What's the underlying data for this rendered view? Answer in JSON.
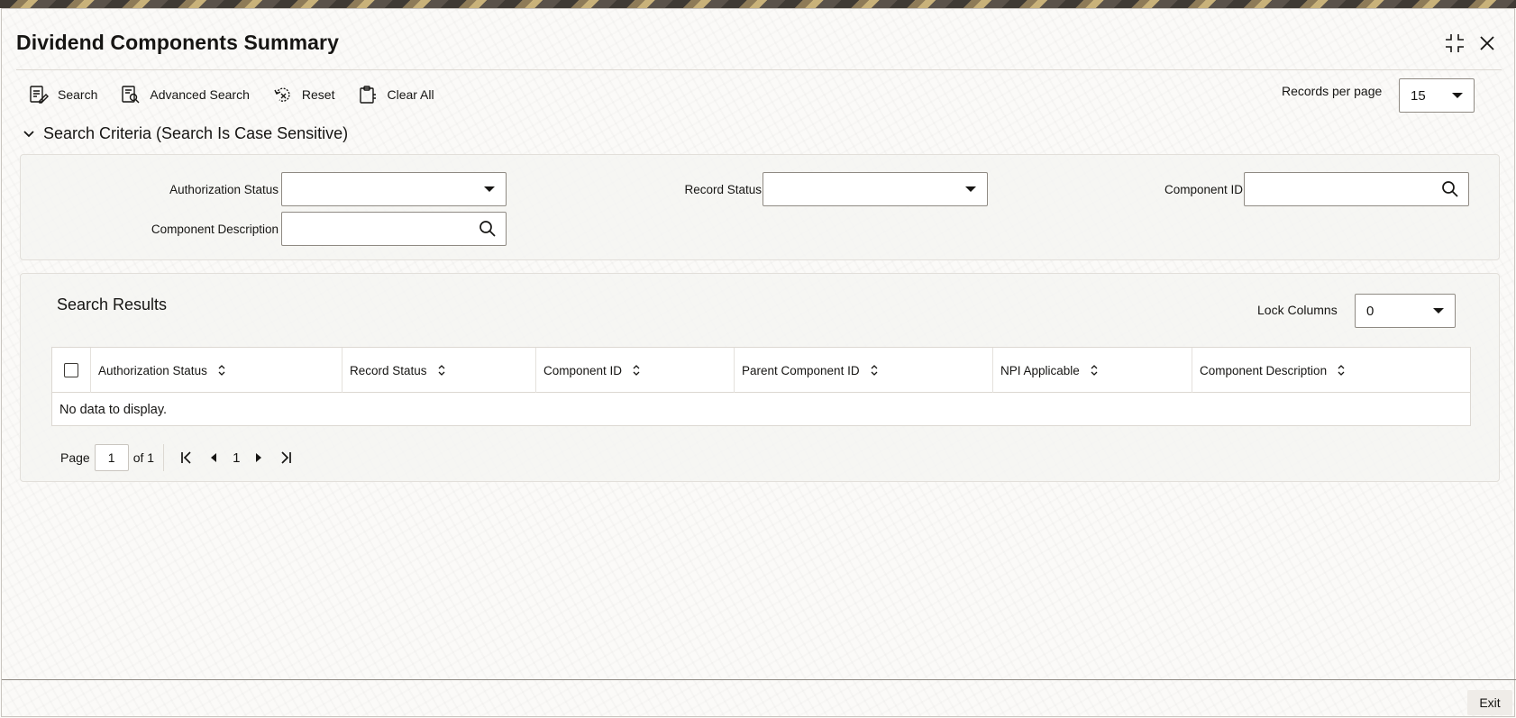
{
  "window": {
    "title": "Dividend Components Summary",
    "controls": {
      "expand_icon": "expand-icon",
      "close_icon": "close-icon"
    }
  },
  "toolbar": {
    "search": "Search",
    "advanced_search": "Advanced Search",
    "reset": "Reset",
    "clear_all": "Clear All",
    "records_per_page_label": "Records per page",
    "records_per_page_value": "15"
  },
  "criteria": {
    "title": "Search Criteria (Search Is Case Sensitive)",
    "fields": {
      "authorization_status": {
        "label": "Authorization Status",
        "value": ""
      },
      "record_status": {
        "label": "Record Status",
        "value": ""
      },
      "component_id": {
        "label": "Component ID",
        "value": ""
      },
      "component_description": {
        "label": "Component Description",
        "value": ""
      }
    }
  },
  "results": {
    "title": "Search Results",
    "lock_columns_label": "Lock Columns",
    "lock_columns_value": "0",
    "columns": [
      "Authorization Status",
      "Record Status",
      "Component ID",
      "Parent Component ID",
      "NPI Applicable",
      "Component Description"
    ],
    "rows": [],
    "empty_message": "No data to display."
  },
  "pagination": {
    "page_label": "Page",
    "current_page": "1",
    "of_label": "of 1",
    "page_number": "1"
  },
  "footer": {
    "exit": "Exit"
  },
  "colors": {
    "text": "#161513",
    "border": "#8f8a83",
    "panel": "#f5f4f2"
  }
}
